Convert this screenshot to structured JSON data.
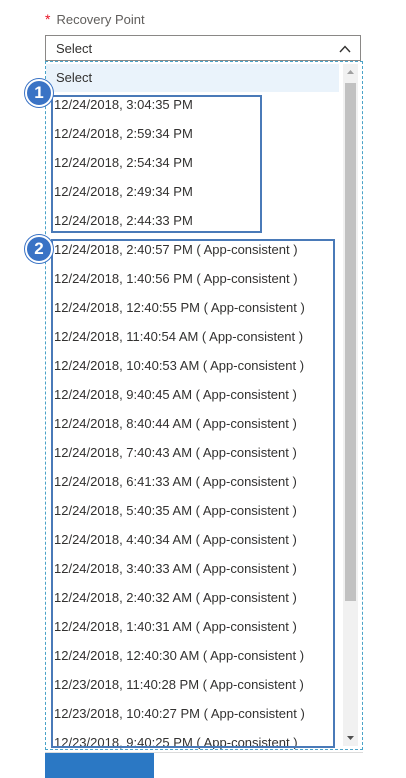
{
  "field": {
    "required_mark": "*",
    "label": "Recovery Point"
  },
  "select": {
    "value": "Select",
    "icon": "chevron-up-icon"
  },
  "dropdown": {
    "placeholder_option": "Select",
    "badges": [
      "1",
      "2"
    ],
    "options": [
      "12/24/2018, 3:04:35 PM",
      "12/24/2018, 2:59:34 PM",
      "12/24/2018, 2:54:34 PM",
      "12/24/2018, 2:49:34 PM",
      "12/24/2018, 2:44:33 PM",
      "12/24/2018, 2:40:57 PM ( App-consistent )",
      "12/24/2018, 1:40:56 PM ( App-consistent )",
      "12/24/2018, 12:40:55 PM ( App-consistent )",
      "12/24/2018, 11:40:54 AM ( App-consistent )",
      "12/24/2018, 10:40:53 AM ( App-consistent )",
      "12/24/2018, 9:40:45 AM ( App-consistent )",
      "12/24/2018, 8:40:44 AM ( App-consistent )",
      "12/24/2018, 7:40:43 AM ( App-consistent )",
      "12/24/2018, 6:41:33 AM ( App-consistent )",
      "12/24/2018, 5:40:35 AM ( App-consistent )",
      "12/24/2018, 4:40:34 AM ( App-consistent )",
      "12/24/2018, 3:40:33 AM ( App-consistent )",
      "12/24/2018, 2:40:32 AM ( App-consistent )",
      "12/24/2018, 1:40:31 AM ( App-consistent )",
      "12/24/2018, 12:40:30 AM ( App-consistent )",
      "12/23/2018, 11:40:28 PM ( App-consistent )",
      "12/23/2018, 10:40:27 PM ( App-consistent )",
      "12/23/2018, 9:40:25 PM ( App-consistent )"
    ]
  },
  "colors": {
    "accent": "#3a73c5",
    "required": "#e81123",
    "highlight": "#eaf3fb",
    "group_border": "#4a7ab8"
  }
}
